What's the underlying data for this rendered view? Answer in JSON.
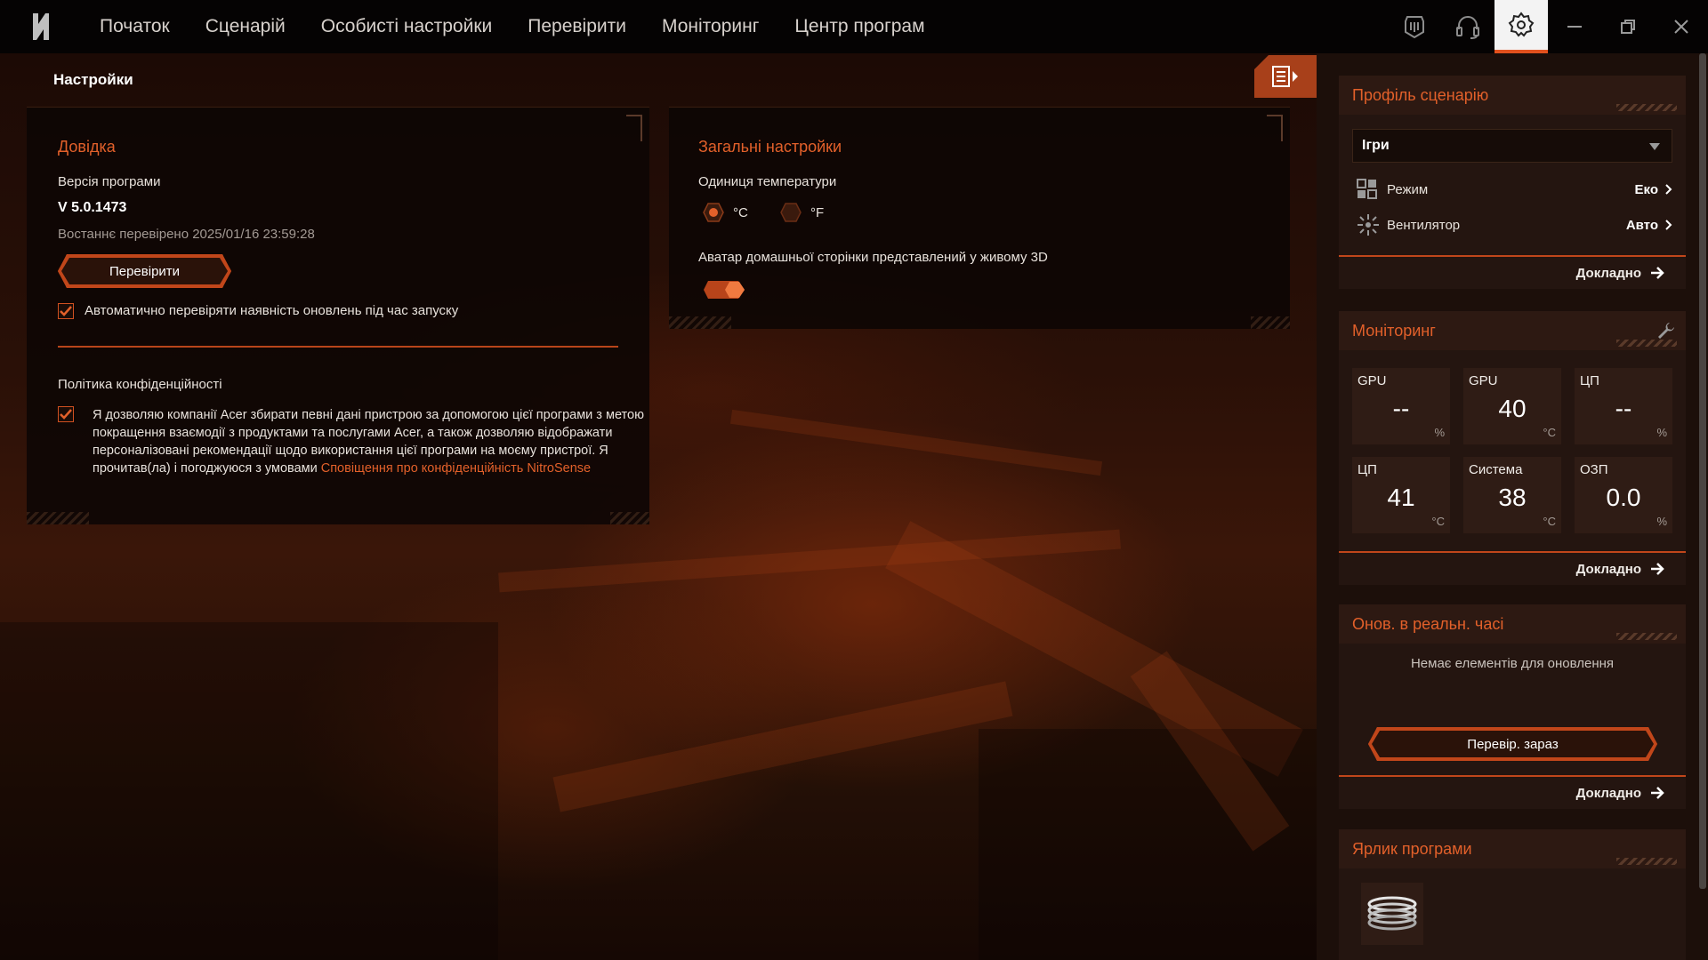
{
  "nav": {
    "items": [
      "Початок",
      "Сценарій",
      "Особисті настройки",
      "Перевірити",
      "Моніторинг",
      "Центр програм"
    ]
  },
  "page": {
    "title": "Настройки"
  },
  "about": {
    "title": "Довідка",
    "version_label": "Версія програми",
    "version_value": "V 5.0.1473",
    "last_checked": "Востаннє перевірено 2025/01/16 23:59:28",
    "check_button": "Перевірити",
    "auto_check_label": "Автоматично перевіряти наявність оновлень під час запуску",
    "auto_check_checked": true,
    "privacy_title": "Політика конфіденційності",
    "privacy_text": "Я дозволяю компанії Acer збирати певні дані пристрою за допомогою цієї програми з метою покращення взаємодії з продуктами та послугами Acer, а також дозволяю відображати персоналізовані рекомендації щодо використання цієї програми на моєму пристрої. Я прочитав(ла) і погоджуюся з умовами",
    "privacy_link": "Сповіщення про конфіденційність NitroSense",
    "privacy_checked": true
  },
  "general": {
    "title": "Загальні настройки",
    "temp_unit_label": "Одиниця температури",
    "unit_c": "°C",
    "unit_f": "°F",
    "selected_unit": "°C",
    "avatar_label": "Аватар домашньої сторінки представлений у живому 3D",
    "avatar_enabled": true
  },
  "sidebar": {
    "profile": {
      "title": "Профіль сценарію",
      "selected": "Ігри",
      "mode_label": "Режим",
      "mode_value": "Еко",
      "fan_label": "Вентилятор",
      "fan_value": "Авто",
      "more": "Докладно"
    },
    "monitoring": {
      "title": "Моніторинг",
      "tiles": [
        {
          "label": "GPU",
          "value": "--",
          "unit": "%"
        },
        {
          "label": "GPU",
          "value": "40",
          "unit": "°C"
        },
        {
          "label": "ЦП",
          "value": "--",
          "unit": "%"
        },
        {
          "label": "ЦП",
          "value": "41",
          "unit": "°C"
        },
        {
          "label": "Система",
          "value": "38",
          "unit": "°C"
        },
        {
          "label": "ОЗП",
          "value": "0.0",
          "unit": "%"
        }
      ],
      "more": "Докладно"
    },
    "updates": {
      "title": "Онов. в реальн. часі",
      "empty": "Немає елементів для оновлення",
      "check_now": "Перевір. зараз",
      "more": "Докладно"
    },
    "shortcut": {
      "title": "Ярлик програми"
    }
  },
  "colors": {
    "accent": "#e2602a",
    "border": "#c1461a",
    "topbar": "#050303",
    "sidebar": "#1c0f0a"
  },
  "icons": {
    "logo": "nitro-logo-icon",
    "top": [
      "keyboard-icon",
      "headset-icon",
      "settings-icon",
      "minimize-icon",
      "restore-icon",
      "close-icon"
    ]
  }
}
